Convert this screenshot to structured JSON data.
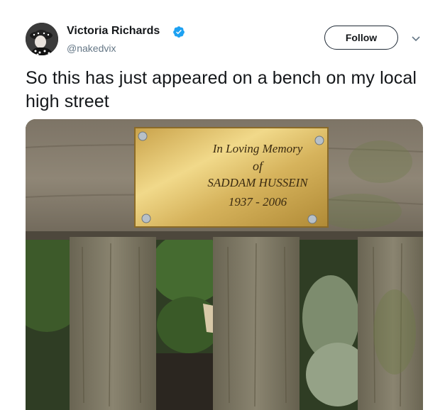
{
  "tweet": {
    "author": {
      "display_name": "Victoria Richards",
      "handle": "@nakedvix",
      "verified": true,
      "verified_icon": "verified-badge-icon",
      "verified_color": "#1da1f2"
    },
    "follow_label": "Follow",
    "menu_icon": "chevron-down-icon",
    "text": "So this has just appeared on a bench on my local high street",
    "media": {
      "plaque": {
        "line1": "In Loving Memory",
        "line2": "of",
        "line3": "SADDAM HUSSEIN",
        "line4": "1937 - 2006"
      }
    }
  }
}
